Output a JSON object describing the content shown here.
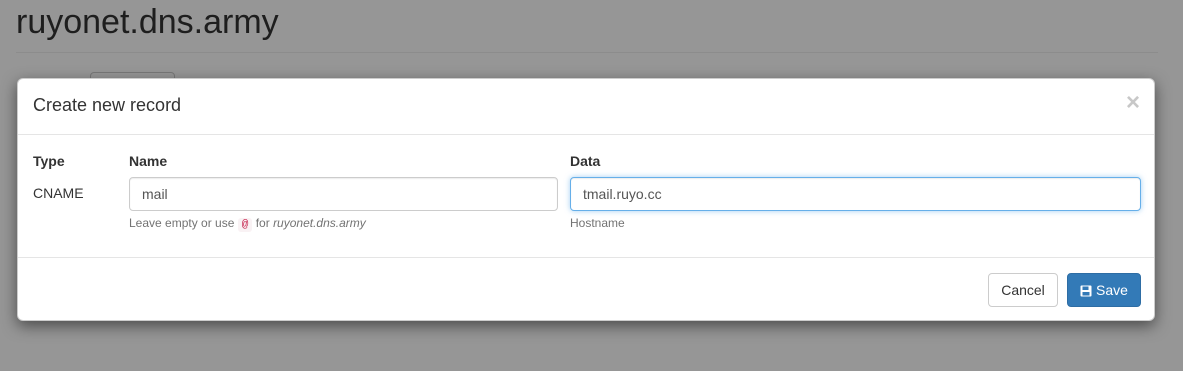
{
  "page": {
    "title": "ruyonet.dns.army"
  },
  "modal": {
    "title": "Create new record",
    "close_symbol": "×",
    "type": {
      "label": "Type",
      "value": "CNAME"
    },
    "name": {
      "label": "Name",
      "value": "mail",
      "help_prefix": "Leave empty or use",
      "help_code": "@",
      "help_middle": "for",
      "help_domain": "ruyonet.dns.army"
    },
    "data": {
      "label": "Data",
      "value": "tmail.ruyo.cc",
      "help": "Hostname"
    },
    "buttons": {
      "cancel": "Cancel",
      "save": "Save"
    }
  },
  "colors": {
    "primary": "#337ab7",
    "focus_border": "#66afe9",
    "code": "#c7254e"
  }
}
